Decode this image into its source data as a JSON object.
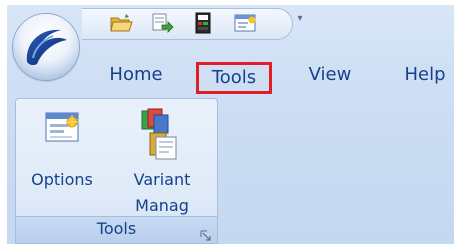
{
  "tabs": [
    {
      "label": "Home"
    },
    {
      "label": "Tools",
      "selected": true
    },
    {
      "label": "View"
    },
    {
      "label": "Help"
    }
  ],
  "quick_access": [
    {
      "icon": "open-folder-icon"
    },
    {
      "icon": "save-green-arrow-icon"
    },
    {
      "icon": "device-icon"
    },
    {
      "icon": "options-window-icon"
    }
  ],
  "group": {
    "label": "Tools",
    "buttons": [
      {
        "label_line1": "Options",
        "label_line2": "",
        "icon": "options-window-icon"
      },
      {
        "label_line1": "Variant",
        "label_line2": "Manag",
        "icon": "variant-manager-icon"
      }
    ]
  },
  "colors": {
    "tab_text": "#15428b",
    "active_tab_border": "#e01e26",
    "ribbon_bg": "#cfdff4"
  }
}
